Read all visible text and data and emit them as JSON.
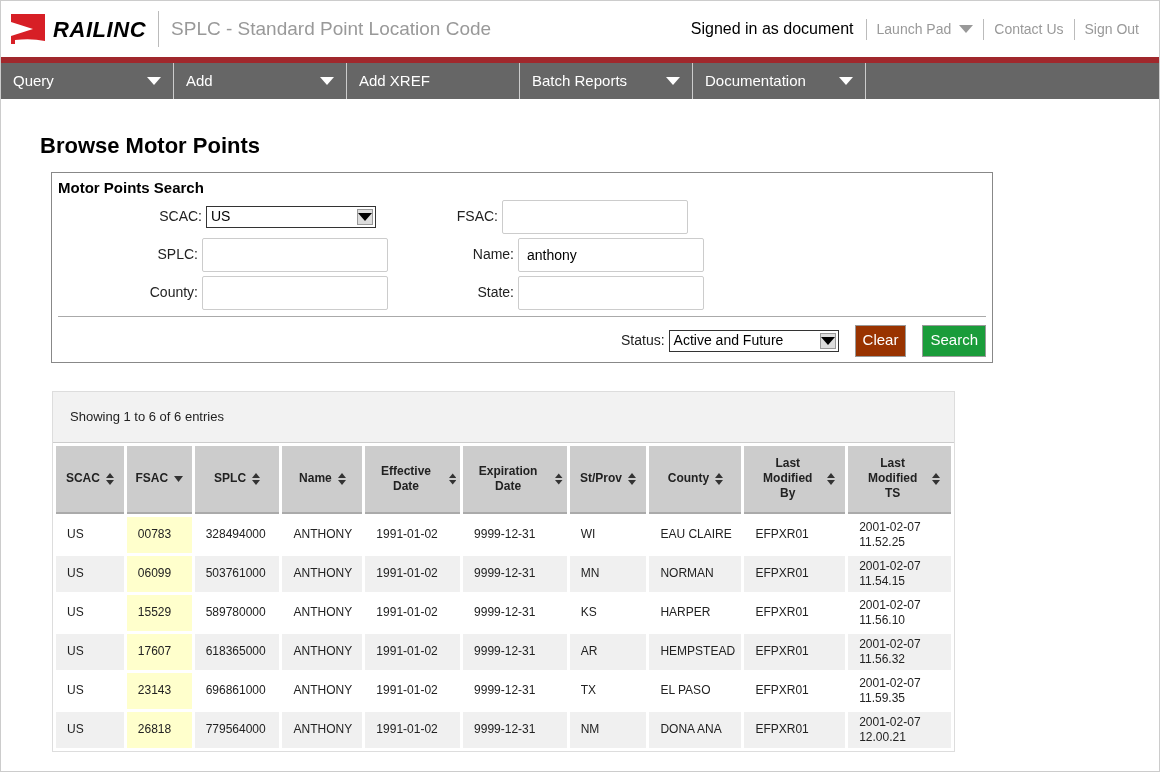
{
  "header": {
    "logo": "RAILINC",
    "app_title": "SPLC - Standard Point Location Code",
    "signed_in": "Signed in as document",
    "links": [
      {
        "label": "Launch Pad",
        "kind": "dropdown"
      },
      {
        "label": "Contact Us",
        "kind": "link"
      },
      {
        "label": "Sign Out",
        "kind": "link"
      }
    ]
  },
  "nav": [
    {
      "label": "Query",
      "dropdown": true
    },
    {
      "label": "Add",
      "dropdown": true
    },
    {
      "label": "Add XREF",
      "dropdown": false
    },
    {
      "label": "Batch Reports",
      "dropdown": true
    },
    {
      "label": "Documentation",
      "dropdown": true
    }
  ],
  "page_title": "Browse Motor Points",
  "search": {
    "title": "Motor Points Search",
    "scac": {
      "label": "SCAC:",
      "value": "US"
    },
    "fsac": {
      "label": "FSAC:"
    },
    "splc": {
      "label": "SPLC:"
    },
    "name": {
      "label": "Name:",
      "value": "anthony"
    },
    "county": {
      "label": "County:"
    },
    "state": {
      "label": "State:"
    },
    "status": {
      "label": "Status:",
      "value": "Active and Future"
    },
    "buttons": [
      {
        "label": "Clear",
        "kind": "clear"
      },
      {
        "label": "Search",
        "kind": "search"
      }
    ]
  },
  "table": {
    "info": "Showing 1 to 6 of 6 entries",
    "columns": [
      {
        "label": "SCAC",
        "sorted": false
      },
      {
        "label": "FSAC",
        "sorted": true
      },
      {
        "label": "SPLC",
        "sorted": false
      },
      {
        "label": "Name",
        "sorted": false
      },
      {
        "label": "Effective Date",
        "sorted": false
      },
      {
        "label": "Expiration Date",
        "sorted": false
      },
      {
        "label": "St/Prov",
        "sorted": false
      },
      {
        "label": "County",
        "sorted": false
      },
      {
        "label": "Last Modified By",
        "sorted": false
      },
      {
        "label": "Last Modified TS",
        "sorted": false
      }
    ],
    "rows": [
      [
        "US",
        "00783",
        "328494000",
        "ANTHONY",
        "1991-01-02",
        "9999-12-31",
        "WI",
        "EAU CLAIRE",
        "EFPXR01",
        "2001-02-07 11.52.25"
      ],
      [
        "US",
        "06099",
        "503761000",
        "ANTHONY",
        "1991-01-02",
        "9999-12-31",
        "MN",
        "NORMAN",
        "EFPXR01",
        "2001-02-07 11.54.15"
      ],
      [
        "US",
        "15529",
        "589780000",
        "ANTHONY",
        "1991-01-02",
        "9999-12-31",
        "KS",
        "HARPER",
        "EFPXR01",
        "2001-02-07 11.56.10"
      ],
      [
        "US",
        "17607",
        "618365000",
        "ANTHONY",
        "1991-01-02",
        "9999-12-31",
        "AR",
        "HEMPSTEAD",
        "EFPXR01",
        "2001-02-07 11.56.32"
      ],
      [
        "US",
        "23143",
        "696861000",
        "ANTHONY",
        "1991-01-02",
        "9999-12-31",
        "TX",
        "EL PASO",
        "EFPXR01",
        "2001-02-07 11.59.35"
      ],
      [
        "US",
        "26818",
        "779564000",
        "ANTHONY",
        "1991-01-02",
        "9999-12-31",
        "NM",
        "DONA ANA",
        "EFPXR01",
        "2001-02-07 12.00.21"
      ]
    ]
  }
}
